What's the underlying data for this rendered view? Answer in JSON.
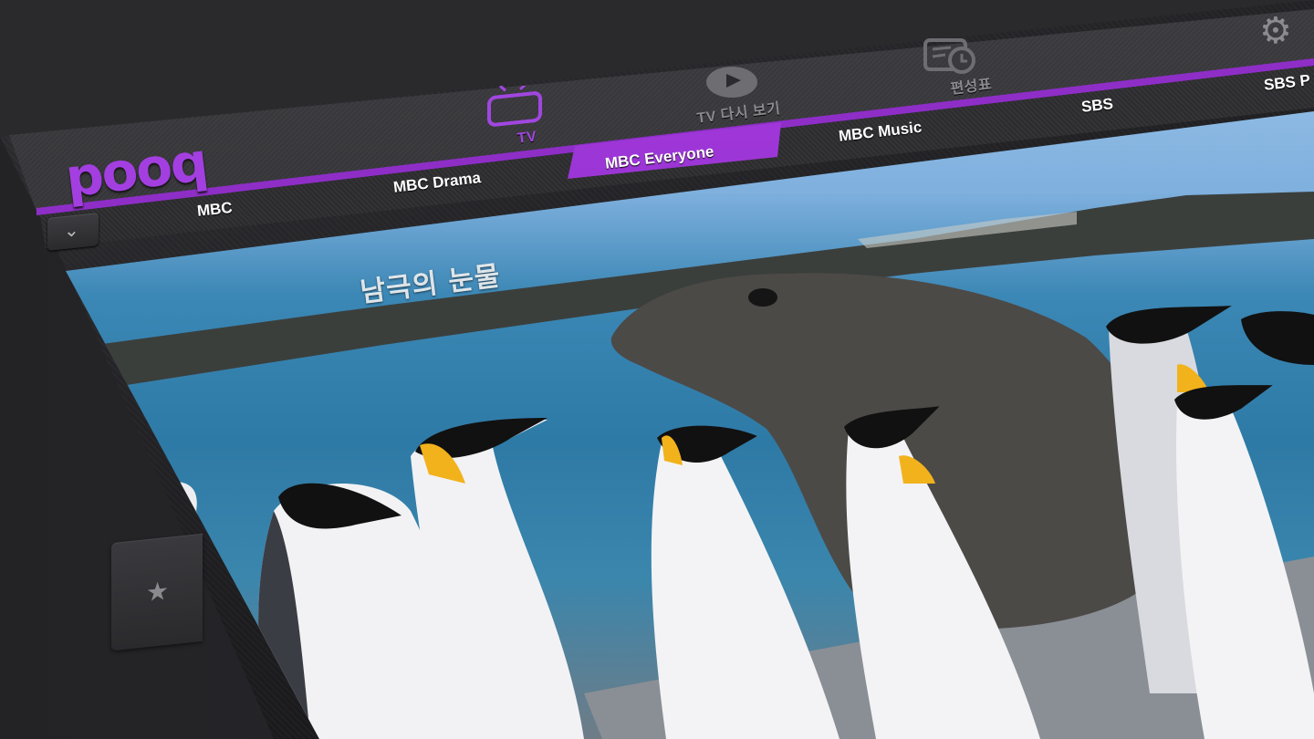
{
  "app": {
    "logo_text": "pooq",
    "brand_color": "#9b34d8"
  },
  "nav": {
    "items": [
      {
        "id": "tv",
        "label": "TV",
        "icon": "tv-icon",
        "active": true
      },
      {
        "id": "replay",
        "label": "TV 다시 보기",
        "icon": "play-icon",
        "active": false
      },
      {
        "id": "schedule",
        "label": "편성표",
        "icon": "schedule-clock-icon",
        "active": false
      }
    ],
    "settings_icon": "gear-icon"
  },
  "channels": {
    "items": [
      {
        "label": "MBC",
        "active": false
      },
      {
        "label": "MBC Drama",
        "active": false
      },
      {
        "label": "MBC Everyone",
        "active": true
      },
      {
        "label": "MBC Music",
        "active": false
      },
      {
        "label": "SBS",
        "active": false
      },
      {
        "label": "SBS P",
        "active": false
      }
    ],
    "expand_icon": "chevron-down-icon"
  },
  "video": {
    "caption": "남극의 눈물"
  },
  "sidebar": {
    "favorite_icon": "star-icon",
    "favorite_symbol": "★"
  },
  "colors": {
    "accent": "#9b34d8",
    "frame": "#2a2a2d",
    "text_inactive": "#8a8a8f"
  }
}
